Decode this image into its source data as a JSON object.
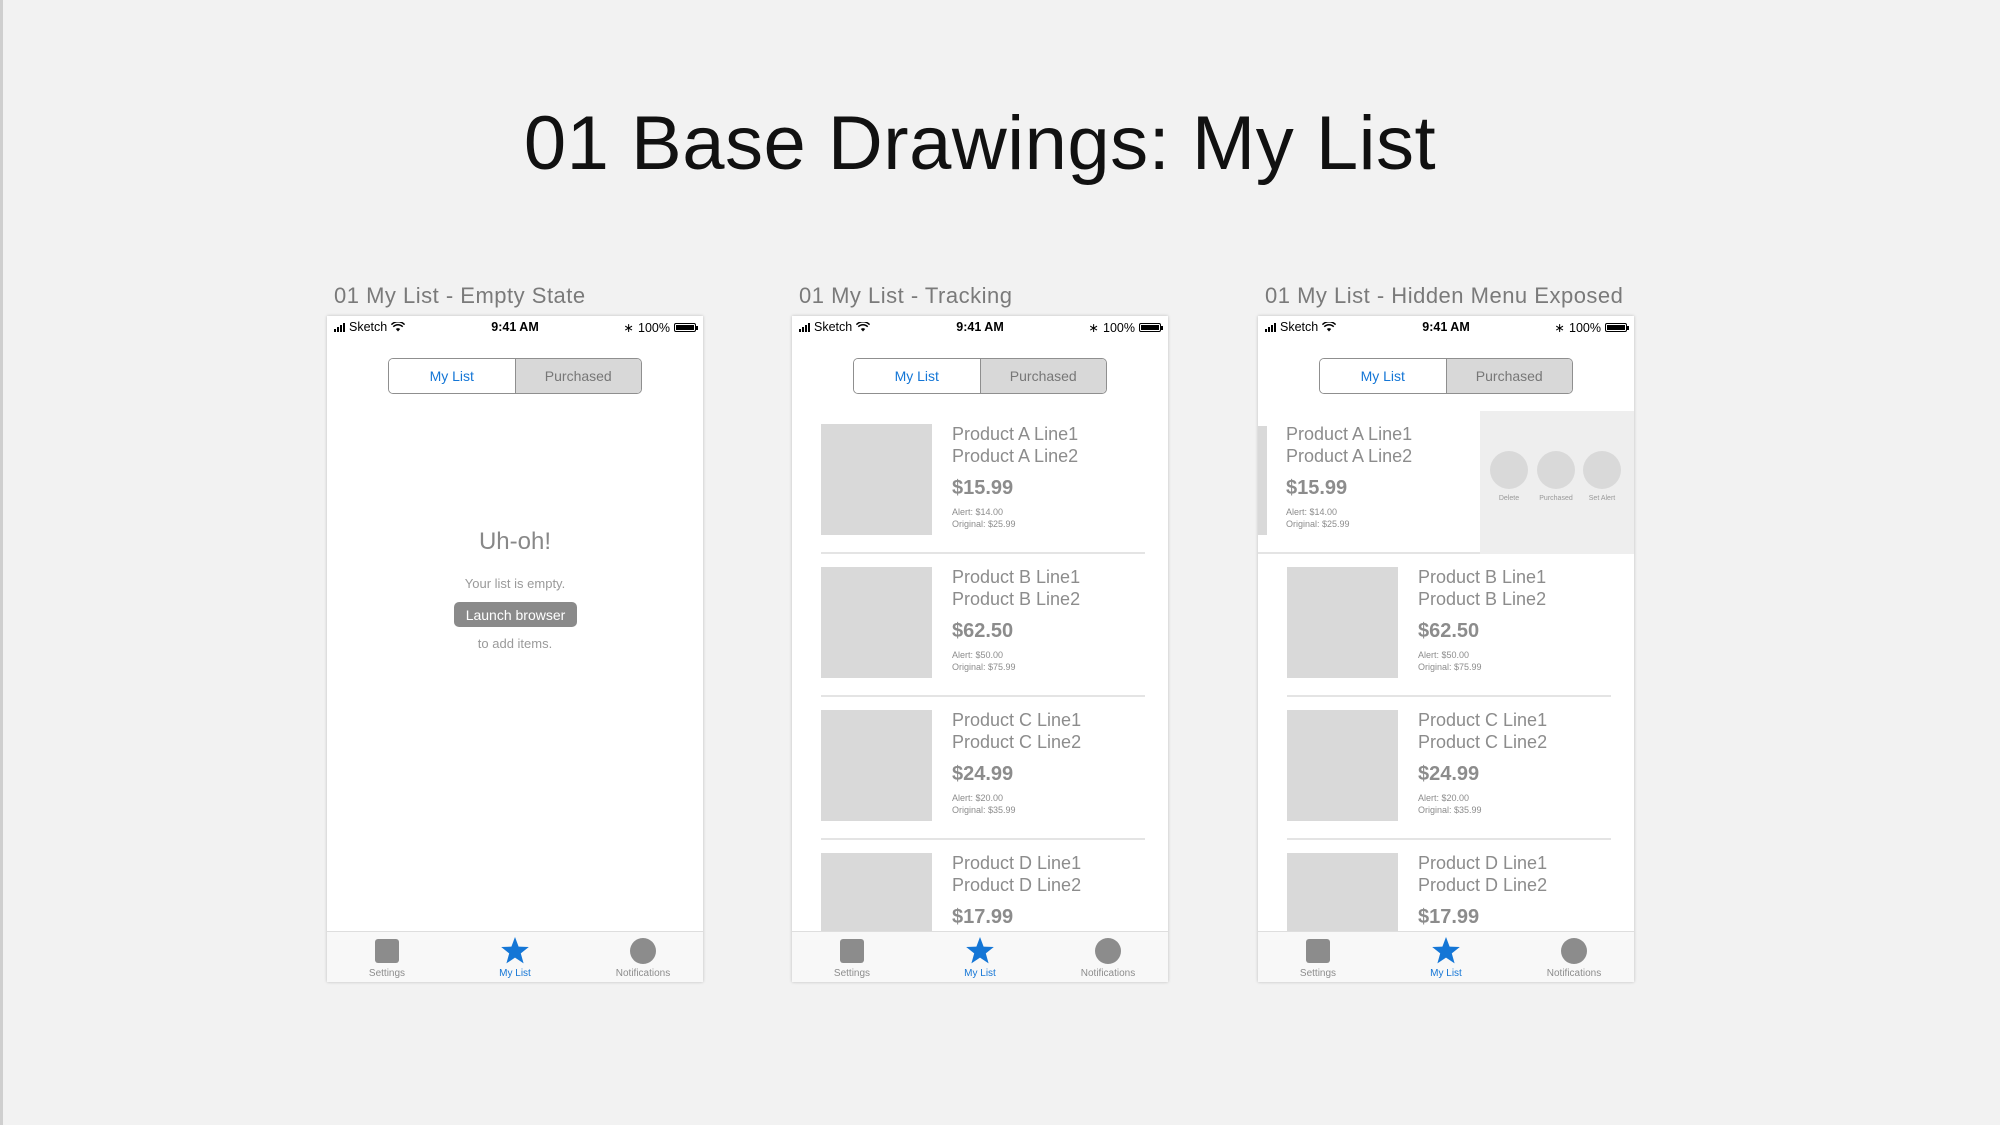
{
  "page": {
    "title": "01 Base Drawings: My List"
  },
  "status_bar": {
    "carrier": "Sketch",
    "time": "9:41 AM",
    "battery": "100%"
  },
  "segment": {
    "my_list": "My List",
    "purchased": "Purchased"
  },
  "tabbar": {
    "settings": "Settings",
    "my_list": "My List",
    "notifications": "Notifications"
  },
  "icons": {
    "settings": "square-icon",
    "my_list": "star-icon",
    "notifications": "circle-icon"
  },
  "colors": {
    "accent": "#1476d6",
    "placeholder": "#d9d9d9",
    "muted_text": "#8c8c8c"
  },
  "artboards": [
    {
      "label": "01 My List - Empty State"
    },
    {
      "label": "01 My List - Tracking"
    },
    {
      "label": "01 My List - Hidden Menu Exposed"
    }
  ],
  "empty_state": {
    "title": "Uh-oh!",
    "message": "Your list is empty.",
    "button": "Launch browser",
    "suffix": "to add items."
  },
  "products": [
    {
      "line1": "Product A Line1",
      "line2": "Product A Line2",
      "price": "$15.99",
      "alert": "Alert: $14.00",
      "original": "Original: $25.99"
    },
    {
      "line1": "Product B Line1",
      "line2": "Product B Line2",
      "price": "$62.50",
      "alert": "Alert: $50.00",
      "original": "Original: $75.99"
    },
    {
      "line1": "Product C Line1",
      "line2": "Product C Line2",
      "price": "$24.99",
      "alert": "Alert: $20.00",
      "original": "Original: $35.99"
    },
    {
      "line1": "Product D Line1",
      "line2": "Product D Line2",
      "price": "$17.99"
    }
  ],
  "hidden_menu": {
    "delete": "Delete",
    "purchased": "Purchased",
    "set_alert": "Set Alert"
  }
}
